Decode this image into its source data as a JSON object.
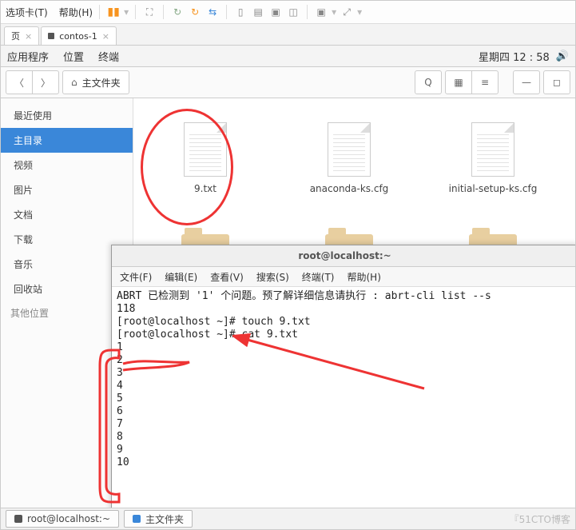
{
  "toolbar": {
    "option_tab": "选项卡(T)",
    "help": "帮助(H)"
  },
  "tabs": [
    {
      "label": "页"
    },
    {
      "label": "contos-1"
    }
  ],
  "gnome_panel": {
    "apps": "应用程序",
    "places": "位置",
    "terminal": "终端",
    "clock": "星期四 12 : 58"
  },
  "nautilus": {
    "location": "主文件夹",
    "sidebar": {
      "recent": "最近使用",
      "home": "主目录",
      "video": "视频",
      "pictures": "图片",
      "documents": "文档",
      "downloads": "下载",
      "music": "音乐",
      "trash": "回收站",
      "other": "其他位置"
    },
    "files": [
      {
        "name": "9.txt",
        "kind": "doc"
      },
      {
        "name": "anaconda-ks.cfg",
        "kind": "doc"
      },
      {
        "name": "initial-setup-ks.cfg",
        "kind": "doc"
      }
    ]
  },
  "terminal": {
    "title": "root@localhost:~",
    "menus": {
      "file": "文件(F)",
      "edit": "编辑(E)",
      "view": "查看(V)",
      "search": "搜索(S)",
      "terminal": "终端(T)",
      "help": "帮助(H)"
    },
    "lines": [
      "ABRT 已检测到 '1' 个问题。预了解详细信息请执行 : abrt-cli list --s",
      "118",
      "[root@localhost ~]# touch 9.txt",
      "[root@localhost ~]# cat 9.txt",
      "1",
      "2",
      "3",
      "4",
      "5",
      "6",
      "7",
      "8",
      "9",
      "10"
    ]
  },
  "taskbar": {
    "term": "root@localhost:~",
    "fm": "主文件夹"
  },
  "watermark": "『51CTO博客"
}
